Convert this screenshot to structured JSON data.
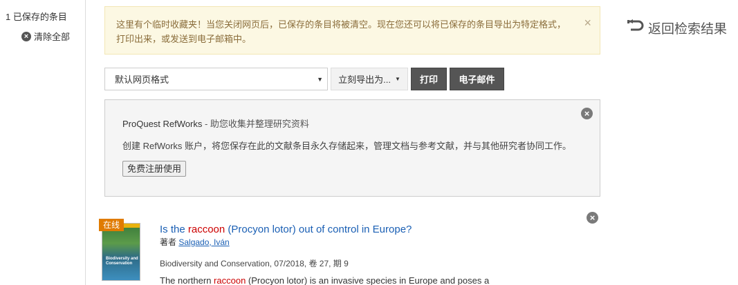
{
  "sidebar": {
    "count_label": "1 已保存的条目",
    "clear_label": "清除全部"
  },
  "notice": {
    "text": "这里有个临时收藏夹！当您关闭网页后，已保存的条目将被清空。现在您还可以将已保存的条目导出为特定格式，打印出来，或发送到电子邮箱中。",
    "close_glyph": "×"
  },
  "back_link": {
    "label": "返回检索结果",
    "icon": "return-arrow-icon"
  },
  "toolbar": {
    "format_selected": "默认网页格式",
    "export_label": "立刻导出为...",
    "print_label": "打印",
    "email_label": "电子邮件"
  },
  "refworks": {
    "brand": "ProQuest RefWorks",
    "tagline": " - 助您收集并整理研究资料",
    "description": "创建 RefWorks 账户，将您保存在此的文献条目永久存储起来，管理文档与参考文献，并与其他研究者协同工作。",
    "signup_label": "免费注册使用"
  },
  "result": {
    "badge": "在线",
    "cover_title": "Biodiversity and Conservation",
    "title_before": "Is the ",
    "title_highlight": "raccoon",
    "title_after": " (Procyon lotor) out of control in Europe?",
    "author_prefix": "著者 ",
    "author_name": "Salgado, Iván",
    "source": "Biodiversity and Conservation, 07/2018, 卷 27, 期 9",
    "abstract_before": "The northern ",
    "abstract_highlight": "raccoon",
    "abstract_after": " (Procyon lotor) is an invasive species in Europe and poses a"
  },
  "colors": {
    "notice_bg": "#fcf8e3",
    "notice_text": "#8a6d3b",
    "link": "#1a5fb4",
    "highlight": "#cc0000",
    "badge": "#e07b00",
    "dark_button": "#555555"
  }
}
